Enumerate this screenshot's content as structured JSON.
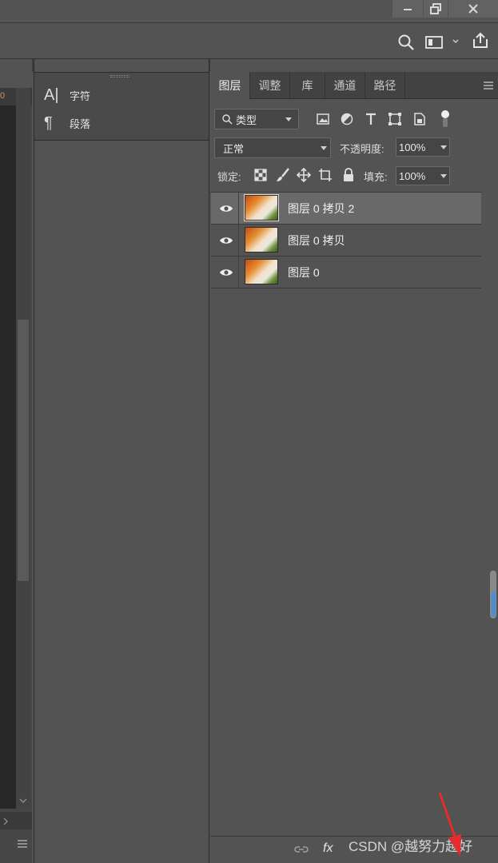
{
  "app": {
    "colors": {
      "bg": "#535353",
      "dark": "#282828",
      "selected_row": "#696969",
      "accent_blue": "#4a8fd4",
      "arrow_red": "#e62c2c"
    }
  },
  "char_panel": {
    "items": [
      {
        "icon": "character-icon",
        "glyph": "A|",
        "label": "字符"
      },
      {
        "icon": "paragraph-icon",
        "glyph": "¶",
        "label": "段落"
      }
    ]
  },
  "doc": {
    "ruler_value": "0"
  },
  "layers_panel": {
    "tabs": [
      {
        "label": "图层",
        "active": true
      },
      {
        "label": "调整",
        "active": false
      },
      {
        "label": "库",
        "active": false
      },
      {
        "label": "通道",
        "active": false
      },
      {
        "label": "路径",
        "active": false
      }
    ],
    "filter_kind": "类型",
    "blend_mode": "正常",
    "opacity_label": "不透明度:",
    "opacity_value": "100%",
    "lock_label": "锁定:",
    "fill_label": "填充:",
    "fill_value": "100%",
    "layers": [
      {
        "name": "图层 0 拷贝 2",
        "selected": true,
        "visible": true
      },
      {
        "name": "图层 0 拷贝",
        "selected": false,
        "visible": true
      },
      {
        "name": "图层 0",
        "selected": false,
        "visible": true
      }
    ]
  },
  "bottom_bar": {
    "fx_label": "fx",
    "watermark": "CSDN @越努力越好"
  }
}
